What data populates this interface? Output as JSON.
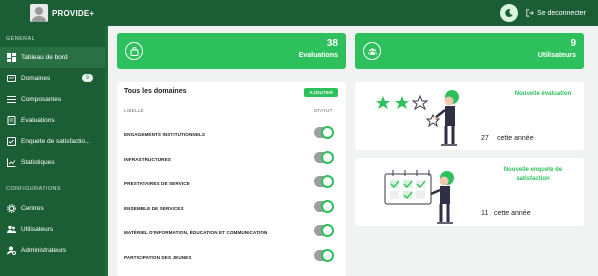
{
  "header": {
    "brand": "PROVIDE+",
    "logout_label": "Se deconnecter"
  },
  "sidebar": {
    "general_title": "GENERAL",
    "config_title": "CONFIGURATIONS",
    "items": [
      {
        "label": "Tableau de bord",
        "icon": "dashboard-icon"
      },
      {
        "label": "Domaines",
        "icon": "folder-icon",
        "badge": "9"
      },
      {
        "label": "Composantes",
        "icon": "list-icon"
      },
      {
        "label": "Evaluations",
        "icon": "document-icon"
      },
      {
        "label": "Enquete de satisfactio...",
        "icon": "survey-icon"
      },
      {
        "label": "Statistiques",
        "icon": "chart-icon"
      }
    ],
    "config_items": [
      {
        "label": "Centres",
        "icon": "settings-icon"
      },
      {
        "label": "Utilisateurs",
        "icon": "users-icon"
      },
      {
        "label": "Administrateurs",
        "icon": "admin-icon"
      }
    ]
  },
  "stats": [
    {
      "value": "38",
      "label": "Evaluations",
      "icon": "bag-icon"
    },
    {
      "value": "9",
      "label": "Utilisateurs",
      "icon": "users-icon"
    }
  ],
  "domains": {
    "title": "Tous les domaines",
    "add_label": "AJOUTER",
    "col_label": "LIBELLÉ",
    "col_status": "STATUT",
    "rows": [
      {
        "name": "ENGAGEMENTS INSTITUTIONNELS",
        "active": true
      },
      {
        "name": "INFRASTRUCTURES",
        "active": true
      },
      {
        "name": "PRESTATAIRES DE SERVICE",
        "active": true
      },
      {
        "name": "ENSEMBLE DE SERVICES",
        "active": true
      },
      {
        "name": "MATÉRIEL D'INFORMATION, ÉDUCATION ET COMMUNICATION",
        "active": true
      },
      {
        "name": "PARTICIPATION DES JEUNES",
        "active": true
      }
    ]
  },
  "cards": [
    {
      "title": "Nouvelle évaluation",
      "count": "27",
      "period": "cette année"
    },
    {
      "title": "Nouvelle enquete de satisfaction",
      "count": "11",
      "period": "cette année"
    }
  ],
  "colors": {
    "primary": "#1b5e35",
    "accent": "#2ec05c"
  }
}
